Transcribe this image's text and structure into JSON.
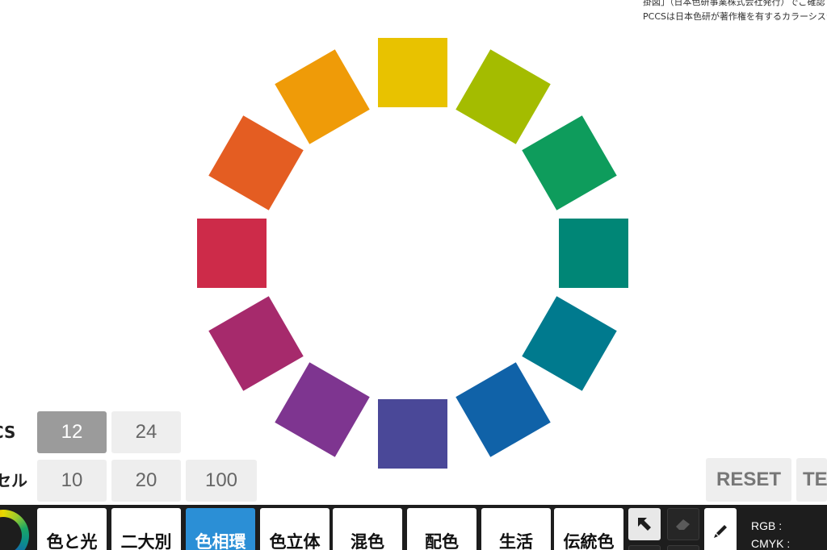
{
  "note": {
    "lines": [
      "",
      "掛図」（日本色研事業株式会社発行）でご確認",
      "PCCSは日本色研が著作権を有するカラーシステム"
    ]
  },
  "wheel": {
    "swatch_colors": [
      "#e8c200",
      "#a4bc00",
      "#0e9c5c",
      "#008676",
      "#007a8e",
      "#1062a8",
      "#4a4898",
      "#7e3590",
      "#a62a6c",
      "#cd2b49",
      "#e45d22",
      "#ef9b08"
    ]
  },
  "selector": {
    "pccs_label": "CS",
    "munsell_label": "セル",
    "pccs_options": [
      "12",
      "24"
    ],
    "munsell_options": [
      "10",
      "20",
      "100"
    ],
    "active": "12"
  },
  "actions": {
    "reset_label": "RESET",
    "text_label": "TE"
  },
  "toolbar": {
    "tabs": [
      {
        "label": "色と光",
        "active": false
      },
      {
        "label": "二大別",
        "active": false
      },
      {
        "label": "色相環",
        "active": true
      },
      {
        "label": "色立体",
        "active": false
      },
      {
        "label": "混色",
        "active": false
      },
      {
        "label": "配色",
        "active": false
      },
      {
        "label": "生活",
        "active": false
      },
      {
        "label": "伝統色",
        "active": false
      }
    ],
    "icons": [
      "pointer-arrow-icon",
      "eraser-icon",
      "pen-icon",
      "color-ring-icon"
    ],
    "rgb_label": "RGB :",
    "cmyk_label": "CMYK :"
  },
  "colors": {
    "toolbar_bg": "#1d1d1d",
    "active_tab": "#2b8fd6",
    "segment_active": "#9b9b9b",
    "segment_inactive": "#eeeeee"
  }
}
